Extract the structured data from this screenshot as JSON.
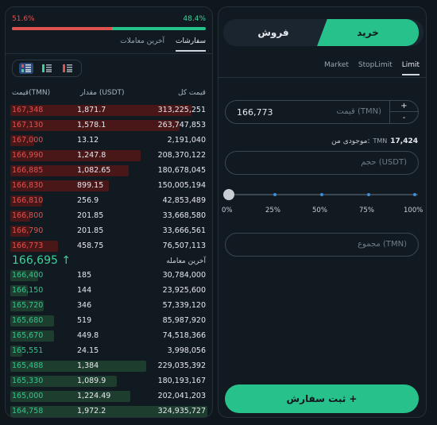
{
  "ratio": {
    "sell_pct": "51.6%",
    "buy_pct": "48.4%",
    "sell_fraction": 0.516
  },
  "left_tabs": {
    "orders": "سفارشات",
    "trades": "آخرین معاملات"
  },
  "book_header": {
    "total": "قیمت کل",
    "amount": "مقدار (USDT)",
    "price": "قیمت(TMN)"
  },
  "asks": [
    {
      "price": "167,348",
      "amount": "1,871.7",
      "total": "313,225,251",
      "depth": 0.92
    },
    {
      "price": "167,130",
      "amount": "1,578.1",
      "total": "263,747,853",
      "depth": 0.86
    },
    {
      "price": "167,000",
      "amount": "13.12",
      "total": "2,191,040",
      "depth": 0.12
    },
    {
      "price": "166,990",
      "amount": "1,247.8",
      "total": "208,370,122",
      "depth": 0.66
    },
    {
      "price": "166,885",
      "amount": "1,082.65",
      "total": "180,678,045",
      "depth": 0.6
    },
    {
      "price": "166,830",
      "amount": "899.15",
      "total": "150,005,194",
      "depth": 0.5
    },
    {
      "price": "166,810",
      "amount": "256.9",
      "total": "42,853,489",
      "depth": 0.16
    },
    {
      "price": "166,800",
      "amount": "201.85",
      "total": "33,668,580",
      "depth": 0.1
    },
    {
      "price": "166,790",
      "amount": "201.85",
      "total": "33,666,561",
      "depth": 0.1
    },
    {
      "price": "166,773",
      "amount": "458.75",
      "total": "76,507,113",
      "depth": 0.24
    }
  ],
  "last_trade": {
    "price": "166,695",
    "label": "آخرین معامله",
    "arrow": "↑"
  },
  "bids": [
    {
      "price": "166,400",
      "amount": "185",
      "total": "30,784,000",
      "depth": 0.14
    },
    {
      "price": "166,150",
      "amount": "144",
      "total": "23,925,600",
      "depth": 0.09
    },
    {
      "price": "165,720",
      "amount": "346",
      "total": "57,339,120",
      "depth": 0.17
    },
    {
      "price": "165,680",
      "amount": "519",
      "total": "85,987,920",
      "depth": 0.22
    },
    {
      "price": "165,670",
      "amount": "449.8",
      "total": "74,518,366",
      "depth": 0.22
    },
    {
      "price": "165,551",
      "amount": "24.15",
      "total": "3,998,056",
      "depth": 0.06
    },
    {
      "price": "165,488",
      "amount": "1,384",
      "total": "229,035,392",
      "depth": 0.69
    },
    {
      "price": "165,330",
      "amount": "1,089.9",
      "total": "180,193,167",
      "depth": 0.54
    },
    {
      "price": "165,000",
      "amount": "1,224.49",
      "total": "202,041,203",
      "depth": 0.61
    },
    {
      "price": "164,758",
      "amount": "1,972.2",
      "total": "324,935,727",
      "depth": 1.0
    }
  ],
  "trade_tabs": {
    "buy": "خرید",
    "sell": "فروش"
  },
  "order_types": {
    "market": "Market",
    "stop_limit": "StopLimit",
    "limit": "Limit"
  },
  "price_input": {
    "value": "166,773",
    "placeholder": "قیمت (TMN)",
    "plus": "+",
    "minus": "-"
  },
  "balance": {
    "label": "موجودی من:",
    "value": "17,424",
    "unit": "TMN"
  },
  "volume_input": {
    "placeholder": "حجم (USDT)"
  },
  "slider": {
    "value_pct": 0,
    "ticks": [
      "0%",
      "25%",
      "50%",
      "75%",
      "100%"
    ]
  },
  "total_input": {
    "placeholder": "مجموع (TMN)"
  },
  "submit": {
    "label": "ثبت سفارش +"
  },
  "colors": {
    "green": "#27c28c",
    "red": "#e0524f"
  }
}
